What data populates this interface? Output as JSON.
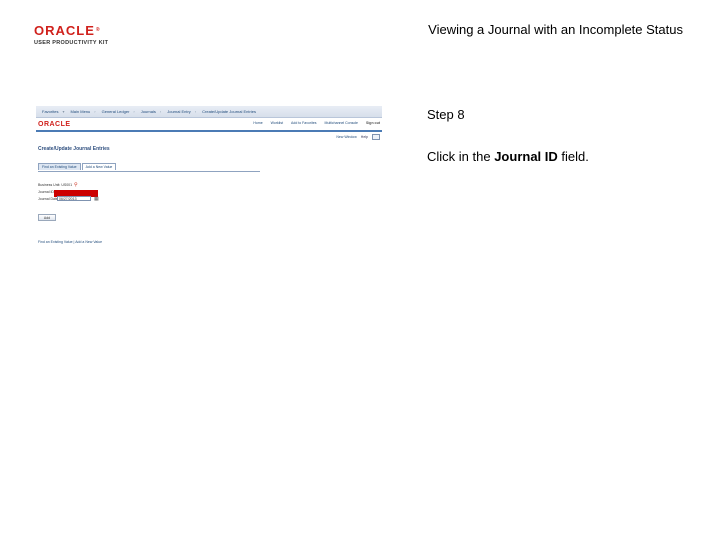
{
  "header": {
    "logo_brand": "ORACLE",
    "logo_tm": "®",
    "logo_subtitle": "USER PRODUCTIVITY KIT",
    "title": "Viewing a Journal with an Incomplete Status"
  },
  "step": {
    "label": "Step 8",
    "instruction_prefix": "Click in the ",
    "instruction_field": "Journal ID",
    "instruction_suffix": " field."
  },
  "screenshot": {
    "menu": [
      "Favorites",
      "Main Menu",
      "General Ledger",
      "Journals",
      "Journal Entry",
      "Create/Update Journal Entries"
    ],
    "brand": "ORACLE",
    "top_links": [
      "Home",
      "Worklist",
      "Add to Favorites",
      "Multichannel Console",
      "Sign out"
    ],
    "nav_links": [
      "New Window",
      "Help"
    ],
    "page_title": "Create/Update Journal Entries",
    "tabs": [
      "Find an Existing Value",
      "Add a New Value"
    ],
    "fields": {
      "business_unit_label": "Business Unit:",
      "business_unit_value": "US001",
      "journal_id_label": "Journal ID:",
      "journal_date_label": "Journal Date:",
      "journal_date_value": "06/27/2013"
    },
    "add_button": "Add",
    "bottom_links": "Find an Existing Value | Add a New Value"
  }
}
